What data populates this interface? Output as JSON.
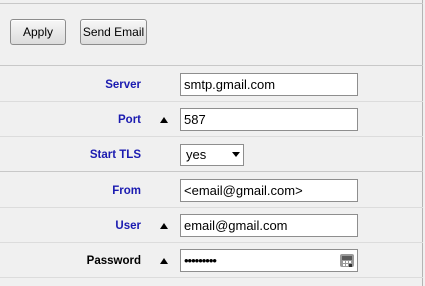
{
  "toolbar": {
    "apply_label": "Apply",
    "send_email_label": "Send Email"
  },
  "form": {
    "server": {
      "label": "Server",
      "value": "smtp.gmail.com"
    },
    "port": {
      "label": "Port",
      "value": "587"
    },
    "start_tls": {
      "label": "Start TLS",
      "value": "yes"
    },
    "from": {
      "label": "From",
      "value": "<email@gmail.com>"
    },
    "user": {
      "label": "User",
      "value": "email@gmail.com"
    },
    "password": {
      "label": "Password",
      "value": "•••••••••"
    }
  },
  "colors": {
    "label_blue": "#1a1ab0",
    "background": "#f0f0f0"
  },
  "icons": {
    "required_marker": "triangle-up-icon",
    "password_manager": "key-icon"
  }
}
